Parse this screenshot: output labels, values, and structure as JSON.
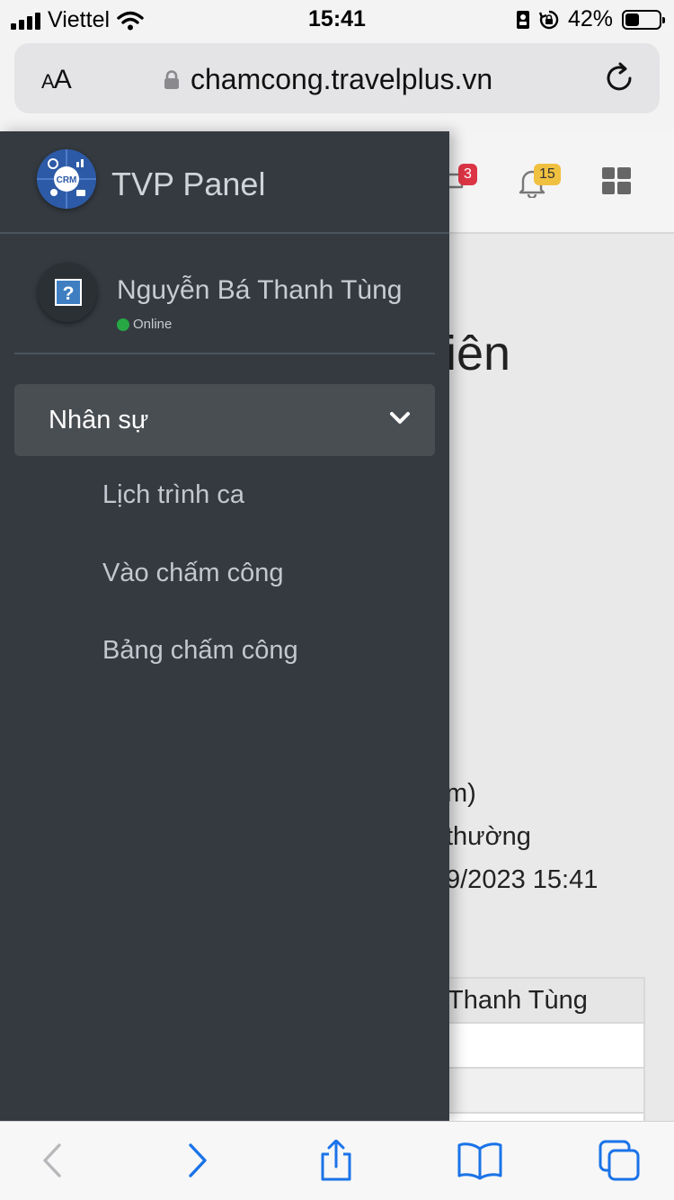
{
  "status_bar": {
    "carrier": "Viettel",
    "time": "15:41",
    "battery_percent": "42%",
    "battery_level": 0.42
  },
  "address_bar": {
    "text_size_label": "AA",
    "url": "chamcong.travelplus.vn",
    "icons": [
      "lock-icon",
      "reload-icon"
    ]
  },
  "background_page": {
    "message_badge": "3",
    "notification_badge": "15",
    "title_fragment": "iên",
    "lines": [
      "m)",
      "thường",
      "9/2023 15:41"
    ],
    "table_cell": "Thanh Tùng",
    "colors": {
      "badge_red": "#dc3545",
      "badge_yellow": "#f0c040"
    }
  },
  "sidebar": {
    "brand_logo_text": "CRM",
    "brand_name": "TVP Panel",
    "user": {
      "name": "Nguyễn Bá Thanh Tùng",
      "status": "Online",
      "avatar_icon": "?"
    },
    "menu": {
      "label": "Nhân sự",
      "items": [
        {
          "label": "Lịch trình ca"
        },
        {
          "label": "Vào chấm công"
        },
        {
          "label": "Bảng chấm công"
        }
      ]
    },
    "colors": {
      "background": "#343a40",
      "active": "#494e53",
      "online": "#28a745"
    }
  },
  "toolbar": {
    "buttons": [
      "back-icon",
      "forward-icon",
      "share-icon",
      "bookmarks-icon",
      "tabs-icon"
    ],
    "accent": "#1a73e8"
  }
}
